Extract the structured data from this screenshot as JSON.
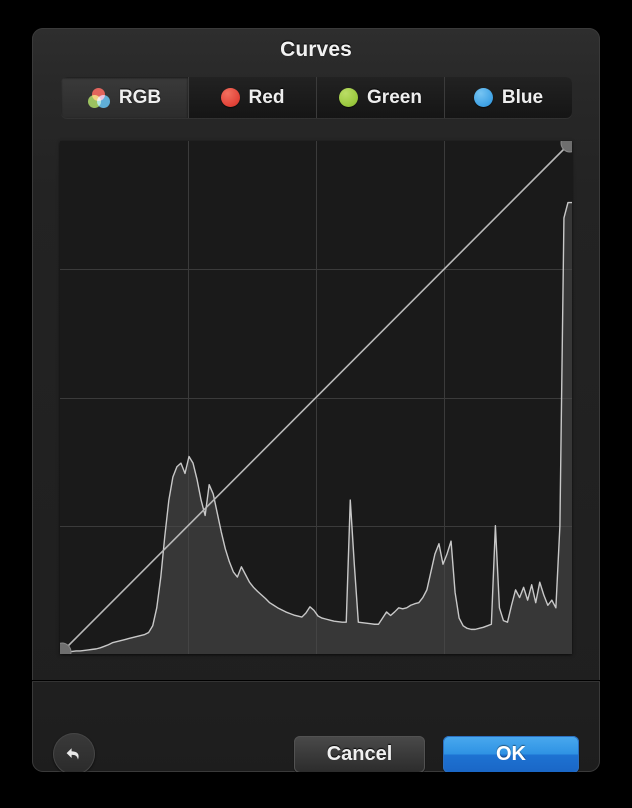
{
  "dialog": {
    "title": "Curves"
  },
  "tabs": [
    {
      "id": "rgb",
      "label": "RGB",
      "icon": "rgb-venn-icon",
      "selected": true,
      "color": "#ffffff"
    },
    {
      "id": "red",
      "label": "Red",
      "icon": "red-swatch-icon",
      "selected": false,
      "color": "#e3453a"
    },
    {
      "id": "green",
      "label": "Green",
      "icon": "green-swatch-icon",
      "selected": false,
      "color": "#9bc93f"
    },
    {
      "id": "blue",
      "label": "Blue",
      "icon": "blue-swatch-icon",
      "selected": false,
      "color": "#42a4e6"
    }
  ],
  "footer": {
    "reset_icon": "undo-arrow-icon",
    "cancel_label": "Cancel",
    "ok_label": "OK",
    "ok_color": "#2f93e4"
  },
  "chart_data": {
    "type": "area",
    "title": "Curves",
    "xlabel": "",
    "ylabel": "",
    "xlim": [
      0,
      255
    ],
    "ylim": [
      0,
      1
    ],
    "grid": true,
    "grid_divisions": 4,
    "legend": "none",
    "curve": {
      "name": "tone-curve",
      "color": "#b4b4b4",
      "points": [
        {
          "x": 0,
          "y": 0
        },
        {
          "x": 255,
          "y": 1
        }
      ],
      "control_points": [
        {
          "id": "black-point",
          "x": 0,
          "y": 0
        },
        {
          "id": "white-point",
          "x": 255,
          "y": 1
        }
      ]
    },
    "histogram": {
      "name": "luminance-histogram",
      "color": "#c8c8c8",
      "fill": "#4a4a4a",
      "bins": 128,
      "values": [
        0.004,
        0.004,
        0.005,
        0.005,
        0.006,
        0.006,
        0.007,
        0.008,
        0.009,
        0.01,
        0.012,
        0.015,
        0.018,
        0.022,
        0.024,
        0.026,
        0.028,
        0.03,
        0.032,
        0.034,
        0.036,
        0.038,
        0.042,
        0.055,
        0.09,
        0.15,
        0.23,
        0.3,
        0.345,
        0.365,
        0.372,
        0.352,
        0.385,
        0.372,
        0.34,
        0.3,
        0.27,
        0.33,
        0.312,
        0.275,
        0.238,
        0.205,
        0.18,
        0.16,
        0.15,
        0.17,
        0.155,
        0.14,
        0.13,
        0.122,
        0.115,
        0.108,
        0.1,
        0.095,
        0.09,
        0.086,
        0.082,
        0.079,
        0.076,
        0.074,
        0.072,
        0.08,
        0.092,
        0.085,
        0.074,
        0.07,
        0.068,
        0.066,
        0.064,
        0.063,
        0.062,
        0.062,
        0.3,
        0.175,
        0.062,
        0.061,
        0.06,
        0.059,
        0.058,
        0.058,
        0.07,
        0.082,
        0.075,
        0.082,
        0.09,
        0.088,
        0.09,
        0.095,
        0.098,
        0.1,
        0.11,
        0.125,
        0.16,
        0.195,
        0.215,
        0.175,
        0.195,
        0.22,
        0.12,
        0.07,
        0.055,
        0.05,
        0.048,
        0.048,
        0.05,
        0.052,
        0.055,
        0.058,
        0.25,
        0.09,
        0.065,
        0.062,
        0.095,
        0.125,
        0.11,
        0.13,
        0.105,
        0.135,
        0.1,
        0.14,
        0.115,
        0.095,
        0.105,
        0.09,
        0.25,
        0.85,
        0.88,
        0.88
      ],
      "peak_highlight": {
        "x": 255,
        "height": 1.0
      }
    }
  }
}
